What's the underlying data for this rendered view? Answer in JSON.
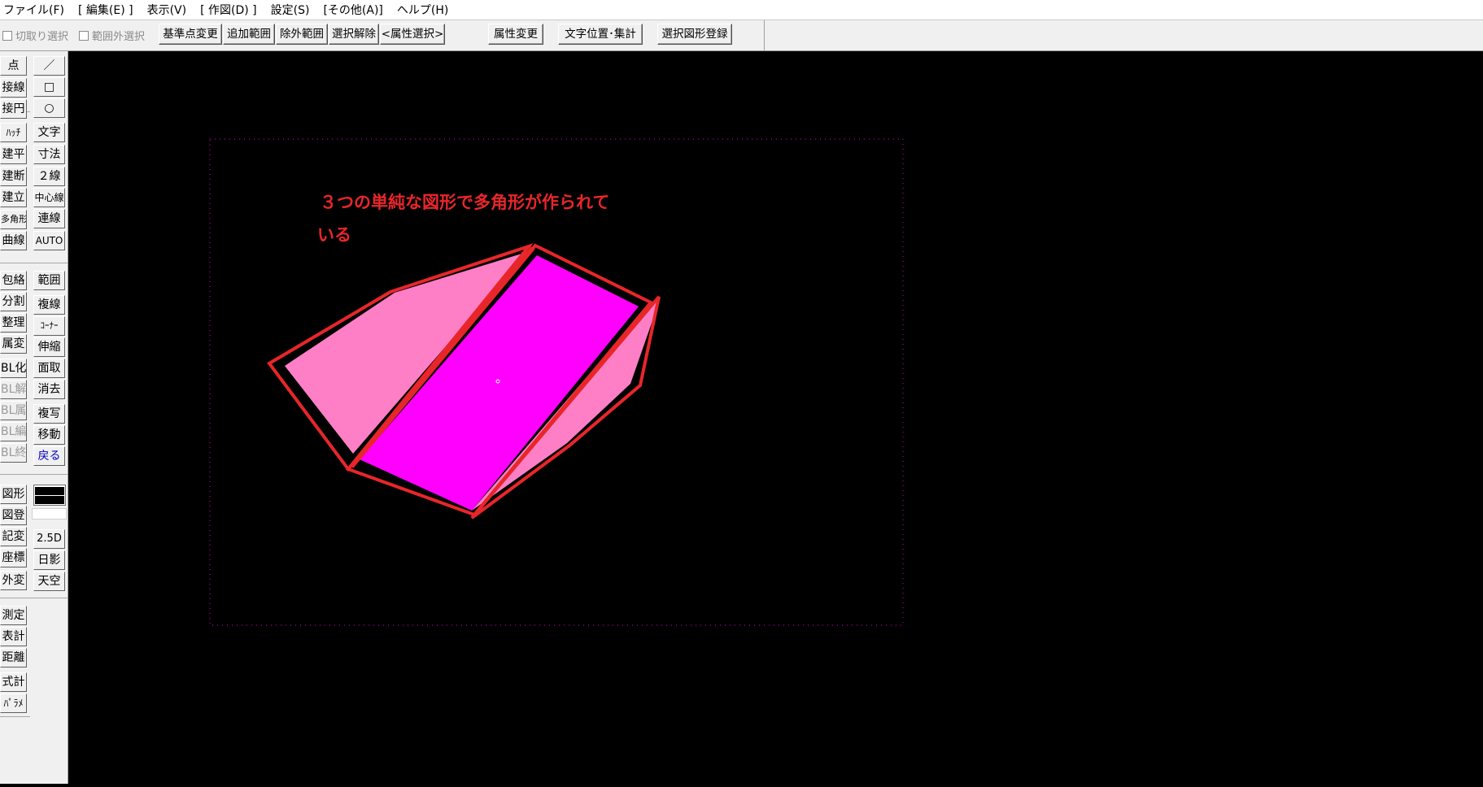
{
  "menu": [
    "ファイル(F)",
    "[ 編集(E) ]",
    "表示(V)",
    "[ 作図(D) ]",
    "設定(S)",
    "[その他(A)]",
    "ヘルプ(H)"
  ],
  "toolbar": {
    "cut_select": "切取り選択",
    "out_of_range_select": "範囲外選択",
    "buttons": [
      "基準点変更",
      "追加範囲",
      "除外範囲",
      "選択解除",
      "<属性選択>",
      "属性変更",
      "文字位置･集計",
      "選択図形登録"
    ]
  },
  "left_col1": [
    "点",
    "接線",
    "接円",
    "ﾊｯﾁ",
    "建平",
    "建断",
    "建立",
    "多角形",
    "曲線",
    "包絡",
    "分割",
    "整理",
    "属変",
    "BL化",
    "BL解",
    "BL属",
    "BL編",
    "BL終",
    "図形",
    "図登",
    "記変",
    "座標",
    "外変",
    "測定",
    "表計",
    "距離",
    "式計",
    "ﾊﾟﾗﾒ"
  ],
  "left_col2": [
    "／",
    "□",
    "○",
    "文字",
    "寸法",
    "２線",
    "中心線",
    "連線",
    "AUTO",
    "範囲",
    "複線",
    "ｺｰﾅｰ",
    "伸縮",
    "面取",
    "消去",
    "複写",
    "移動",
    "戻る",
    "2.5D",
    "日影",
    "天空"
  ],
  "canvas": {
    "annotation_line1": "３つの単純な図形で多角形が作られて",
    "annotation_line2": "いる"
  },
  "colors": {
    "background": "#000000",
    "annotation": "#e8262a",
    "outline": "#e8262a",
    "fill_center": "#ff00ff",
    "fill_sides": "#ff7fc6",
    "frame_dots": "#b000b0"
  }
}
